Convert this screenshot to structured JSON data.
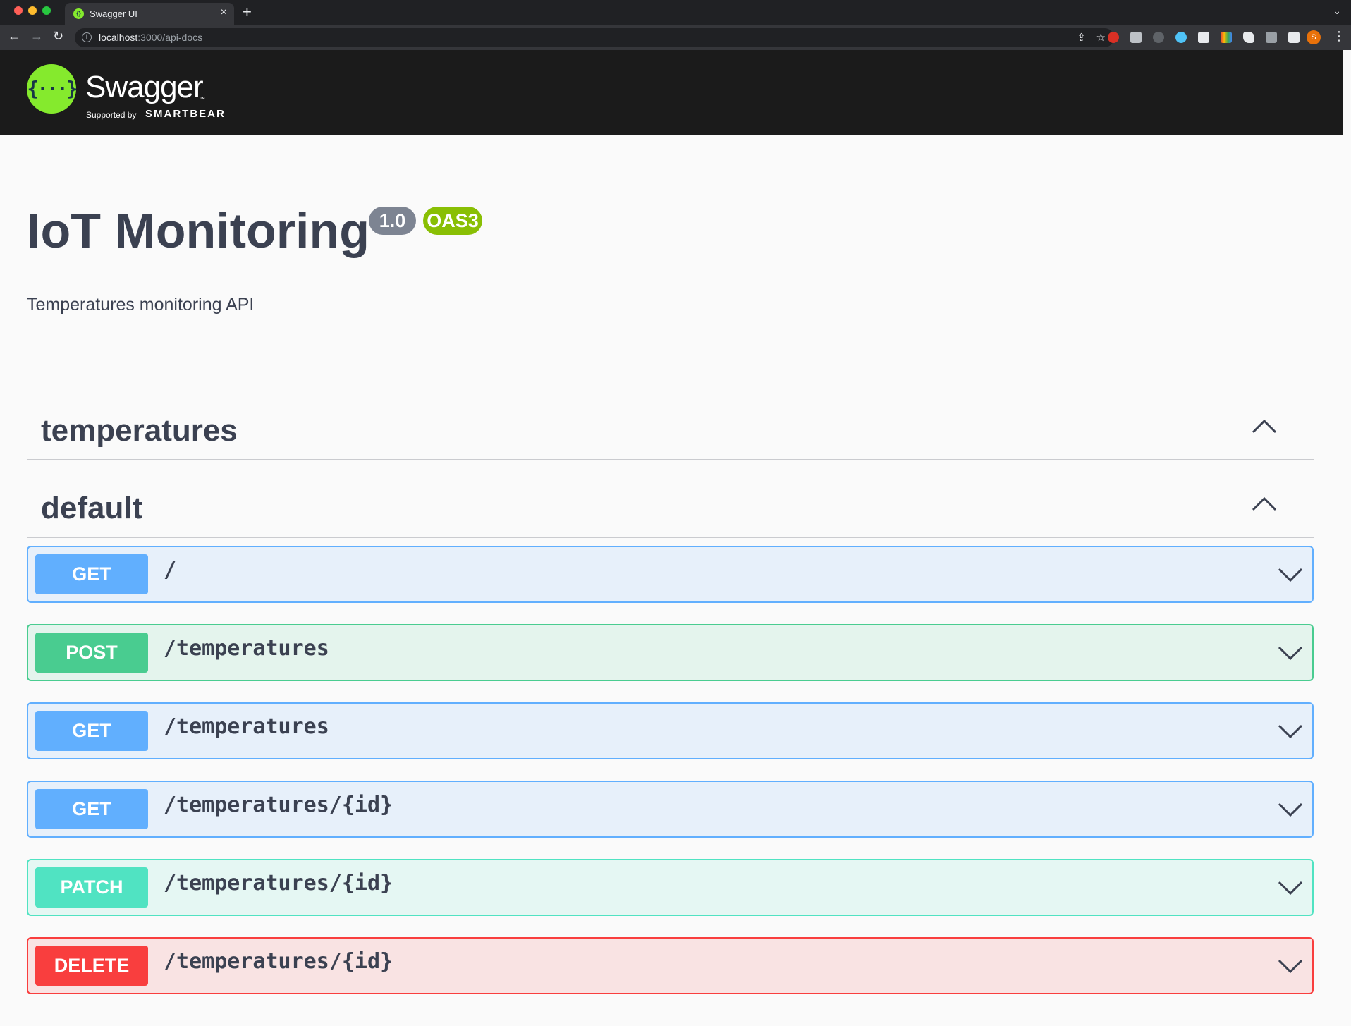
{
  "browser": {
    "tab_title": "Swagger UI",
    "tab_close": "×",
    "new_tab": "+",
    "url_host": "localhost",
    "url_rest": ":3000/api-docs",
    "profile_initial": "S"
  },
  "topbar": {
    "logo_symbol": "{···}",
    "logo_word": "Swagger",
    "logo_tm": "™",
    "supported_by": "Supported by",
    "brand": "SMARTBEAR"
  },
  "info": {
    "title": "IoT Monitoring",
    "version": "1.0",
    "oas": "OAS3",
    "description": "Temperatures monitoring API"
  },
  "tags": [
    {
      "name": "temperatures",
      "expanded": true
    },
    {
      "name": "default",
      "expanded": true
    }
  ],
  "operations": [
    {
      "method": "GET",
      "path": "/"
    },
    {
      "method": "POST",
      "path": "/temperatures"
    },
    {
      "method": "GET",
      "path": "/temperatures"
    },
    {
      "method": "GET",
      "path": "/temperatures/{id}"
    },
    {
      "method": "PATCH",
      "path": "/temperatures/{id}"
    },
    {
      "method": "DELETE",
      "path": "/temperatures/{id}"
    }
  ],
  "colors": {
    "get": "#61affe",
    "post": "#49cc90",
    "patch": "#50e3c2",
    "delete": "#f93e3e",
    "version_badge": "#7d8492",
    "oas_badge": "#89bf04",
    "logo_green": "#85ea2d"
  },
  "icons": {
    "tag_toggle": "chevron-up-icon",
    "op_toggle": "chevron-down-icon"
  }
}
